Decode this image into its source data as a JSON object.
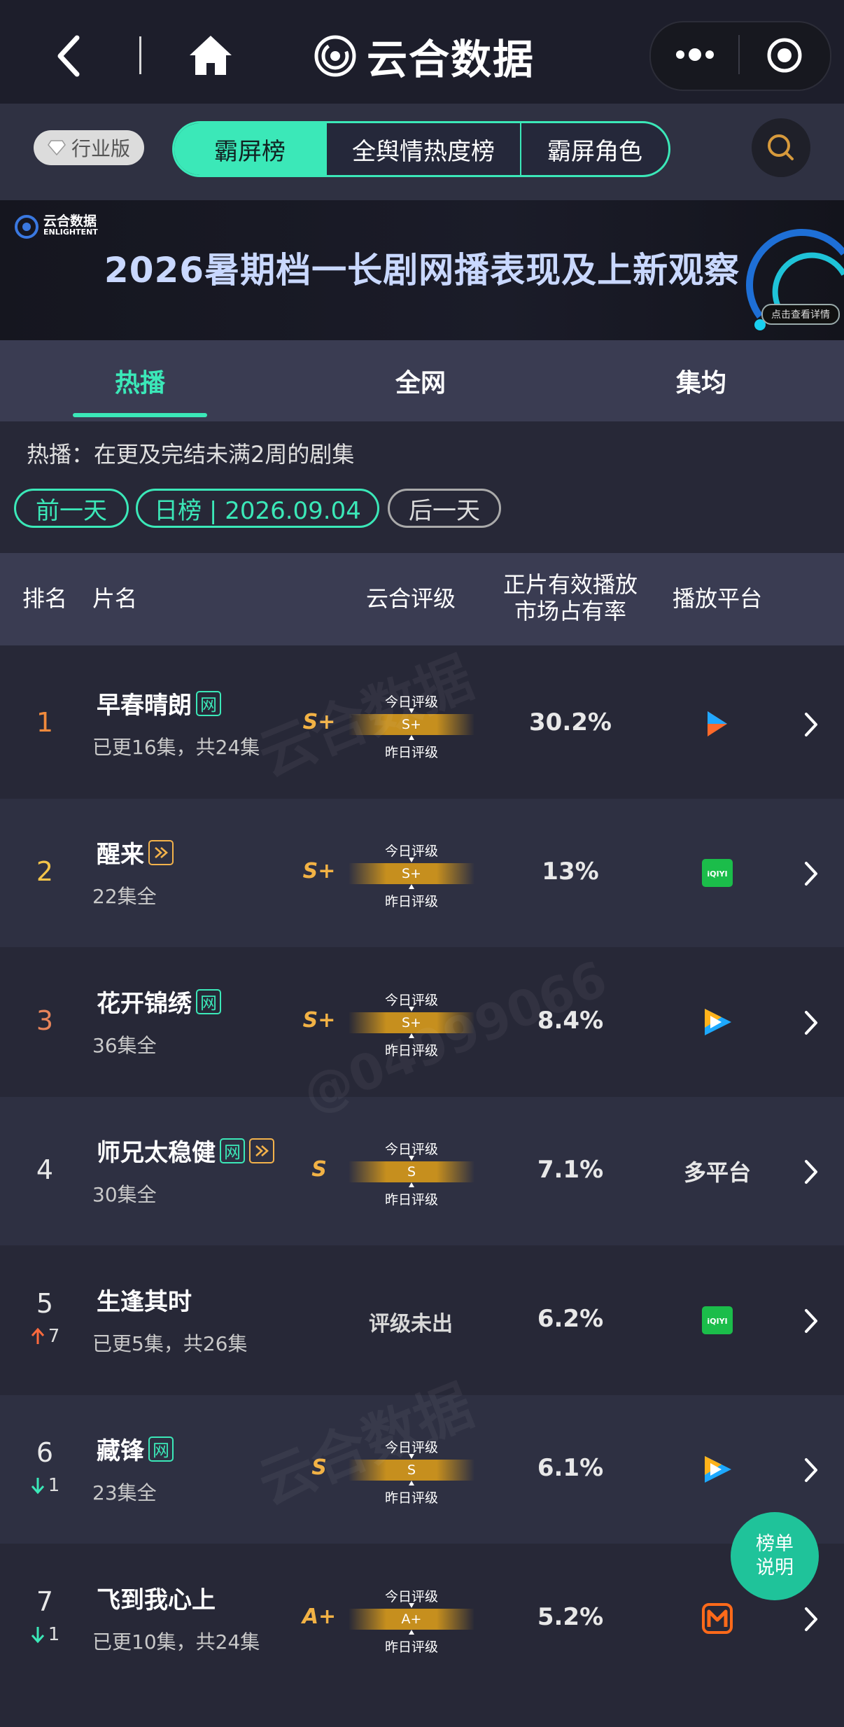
{
  "nav": {
    "brand": "云合数据"
  },
  "header": {
    "edition": "行业版",
    "segments": [
      "霸屏榜",
      "全舆情热度榜",
      "霸屏角色"
    ]
  },
  "banner": {
    "logo_text": "云合数据",
    "logo_sub": "ENLIGHTENT",
    "title": "2026暑期档一长剧网播表现及上新观察",
    "detail": "点击查看详情"
  },
  "tabs": [
    "热播",
    "全网",
    "集均"
  ],
  "hint": "热播：在更及完结未满2周的剧集",
  "date_nav": {
    "prev": "前一天",
    "current": "日榜 | 2026.09.04",
    "next": "后一天"
  },
  "table": {
    "headers": {
      "rank": "排名",
      "title": "片名",
      "rating": "云合评级",
      "share_line1": "正片有效播放",
      "share_line2": "市场占有率",
      "platform": "播放平台"
    },
    "today_label": "今日评级",
    "yesterday_label": "昨日评级",
    "rows": [
      {
        "rank": "1",
        "change": "",
        "title": "早春晴朗",
        "tags": [
          "网"
        ],
        "eps": "已更16集，共24集",
        "grade": "S+",
        "bar": "S+",
        "share": "30.2%",
        "platform": "youku-icon",
        "platform_text": ""
      },
      {
        "rank": "2",
        "change": "",
        "title": "醒来",
        "tags": [
          "播"
        ],
        "eps": "22集全",
        "grade": "S+",
        "bar": "S+",
        "share": "13%",
        "platform": "iqiyi-icon",
        "platform_text": "iQIYI"
      },
      {
        "rank": "3",
        "change": "",
        "title": "花开锦绣",
        "tags": [
          "网"
        ],
        "eps": "36集全",
        "grade": "S+",
        "bar": "S+",
        "share": "8.4%",
        "platform": "tencent-video-icon",
        "platform_text": ""
      },
      {
        "rank": "4",
        "change": "",
        "title": "师兄太稳健",
        "tags": [
          "网",
          "播"
        ],
        "eps": "30集全",
        "grade": "S",
        "bar": "S",
        "share": "7.1%",
        "platform": "multi",
        "platform_text": "多平台"
      },
      {
        "rank": "5",
        "change": "7",
        "change_dir": "up",
        "title": "生逢其时",
        "tags": [],
        "eps": "已更5集，共26集",
        "grade": "",
        "bar": "",
        "no_rating": "评级未出",
        "share": "6.2%",
        "platform": "iqiyi-icon",
        "platform_text": "iQIYI"
      },
      {
        "rank": "6",
        "change": "1",
        "change_dir": "down",
        "title": "藏锋",
        "tags": [
          "网"
        ],
        "eps": "23集全",
        "grade": "S",
        "bar": "S",
        "share": "6.1%",
        "platform": "tencent-video-icon",
        "platform_text": ""
      },
      {
        "rank": "7",
        "change": "1",
        "change_dir": "down",
        "title": "飞到我心上",
        "tags": [],
        "eps": "已更10集，共24集",
        "grade": "A+",
        "bar": "A+",
        "share": "5.2%",
        "platform": "mango-tv-icon",
        "platform_text": ""
      }
    ]
  },
  "fab": {
    "line1": "榜单",
    "line2": "说明"
  },
  "colors": {
    "accent": "#3be8b8",
    "gold": "#f2b245",
    "up": "#ff6a3d",
    "down": "#3be8b8"
  }
}
